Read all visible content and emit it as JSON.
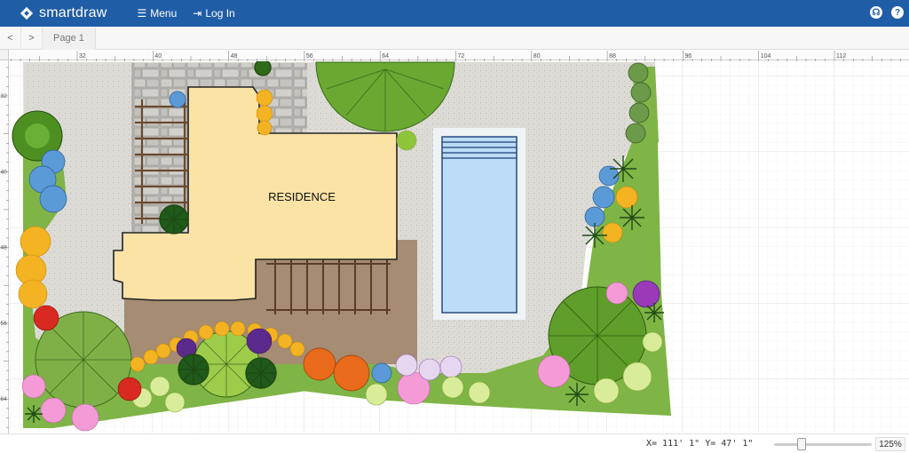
{
  "header": {
    "brand": "smartdraw",
    "menu_label": "Menu",
    "login_label": "Log In"
  },
  "pagebar": {
    "prev": "<",
    "next": ">",
    "page_tab": "Page 1"
  },
  "ruler": {
    "top_ticks": [
      "32",
      "40",
      "48",
      "56",
      "64",
      "72",
      "80",
      "88",
      "96",
      "104",
      "112"
    ],
    "left_ticks": [
      "32",
      "40",
      "48",
      "56",
      "64"
    ]
  },
  "canvas": {
    "residence_label": "RESIDENCE"
  },
  "status": {
    "coords": "X= 111' 1\" Y= 47' 1\"",
    "zoom": "125%",
    "zoom_fraction": 0.25
  },
  "colors": {
    "brand_bar": "#1f5da6",
    "lawn": "#7fb446",
    "residence": "#fbe3a6",
    "deck": "#a58c72",
    "pool_water": "#bcdcf7",
    "gravel": "#dcdad5"
  }
}
